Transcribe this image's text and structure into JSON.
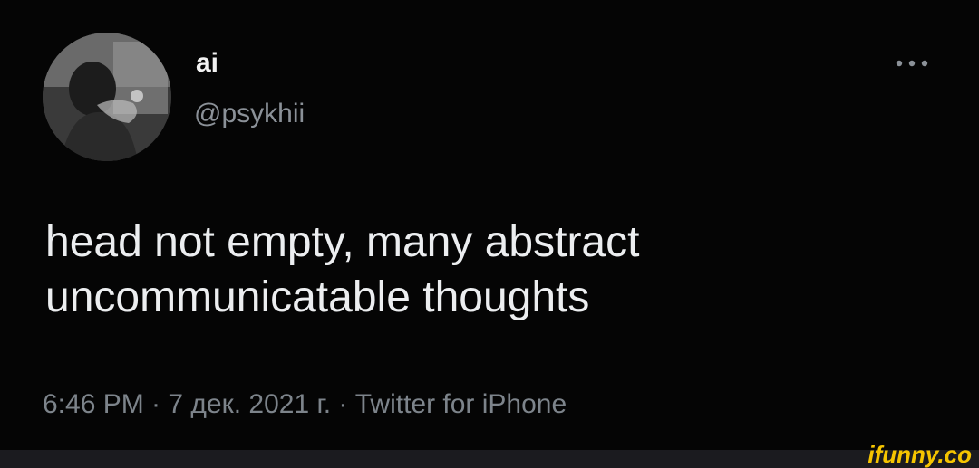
{
  "tweet": {
    "author": {
      "display_name": "ai",
      "handle": "@psykhii",
      "avatar_icon": "profile-photo"
    },
    "more_icon": "ellipsis-icon",
    "text_line_1": "head not empty, many abstract",
    "text_line_2": "uncommunicatable thoughts",
    "meta": "6:46 PM · 7 дек. 2021 г. · Twitter for iPhone"
  },
  "watermark": {
    "text": "ifunny.co",
    "color": "#f5c400"
  },
  "colors": {
    "background": "#000000",
    "text_primary": "#eceef0",
    "text_secondary": "#8b9198"
  }
}
